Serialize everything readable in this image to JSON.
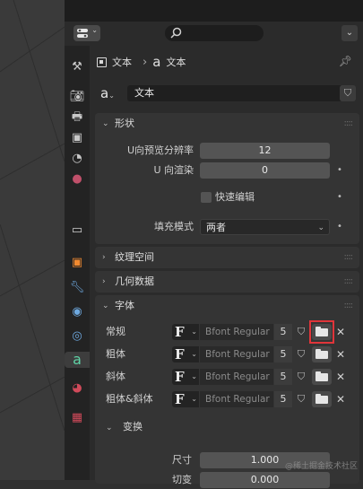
{
  "breadcrumb": {
    "object": "文本",
    "data": "文本"
  },
  "datablock": {
    "name": "文本"
  },
  "panels": {
    "shape": {
      "title": "形状",
      "preview_res_label": "U向预览分辨率",
      "preview_res_value": "12",
      "render_res_label": "U 向渲染",
      "render_res_value": "0",
      "fast_edit_label": "快速编辑",
      "fill_mode_label": "填充模式",
      "fill_mode_value": "两者"
    },
    "texture_space": {
      "title": "纹理空间"
    },
    "geometry": {
      "title": "几何数据"
    },
    "font": {
      "title": "字体",
      "rows": [
        {
          "label": "常规",
          "font": "Bfont Regular",
          "users": "5"
        },
        {
          "label": "粗体",
          "font": "Bfont Regular",
          "users": "5"
        },
        {
          "label": "斜体",
          "font": "Bfont Regular",
          "users": "5"
        },
        {
          "label": "粗体&斜体",
          "font": "Bfont Regular",
          "users": "5"
        }
      ],
      "f_glyph": "F",
      "transform": {
        "title": "变换",
        "size_label": "尺寸",
        "size_value": "1.000",
        "shear_label": "切变",
        "shear_value": "0.000"
      }
    }
  },
  "watermark": "@稀土掘金技术社区",
  "colors": {
    "highlight": "#e0353a",
    "accent_text": "#6ab4f0"
  },
  "icons": [
    "editor-type-icon",
    "search-icon",
    "tool-icon",
    "render-icon",
    "output-icon",
    "view-layer-icon",
    "scene-icon",
    "world-icon",
    "collection-icon",
    "object-icon",
    "modifier-icon",
    "particles-icon",
    "physics-icon",
    "text-data-icon",
    "material-icon",
    "texture-icon",
    "pin-icon",
    "shield-icon",
    "folder-icon",
    "close-icon"
  ]
}
